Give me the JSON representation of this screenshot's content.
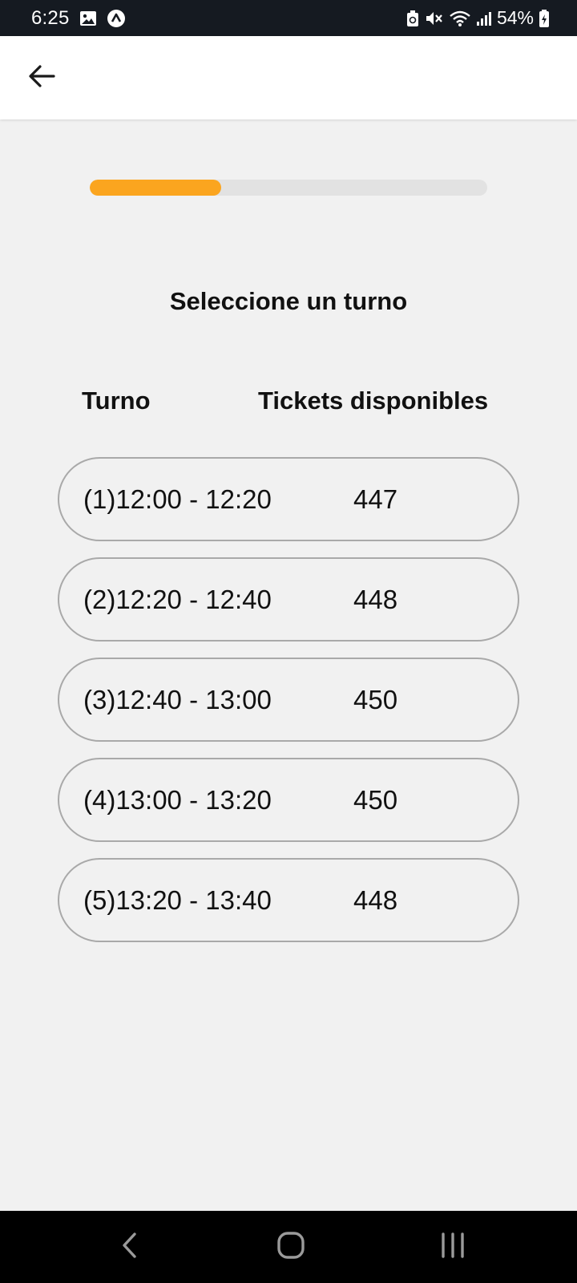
{
  "status_bar": {
    "time": "6:25",
    "battery": "54%",
    "icons": [
      "image-icon",
      "app-notification-icon",
      "recycle-icon",
      "mute-icon",
      "wifi-icon",
      "signal-icon",
      "battery-icon"
    ]
  },
  "app_bar": {
    "back_icon": "arrow-left-icon"
  },
  "progress": {
    "value": 0.33,
    "fill_color": "#fba51f",
    "track_color": "#e2e2e2"
  },
  "title": "Seleccione un turno",
  "columns": {
    "turno": "Turno",
    "tickets": "Tickets disponibles"
  },
  "turns": [
    {
      "time": "(1)12:00 - 12:20",
      "tickets": "447"
    },
    {
      "time": "(2)12:20 - 12:40",
      "tickets": "448"
    },
    {
      "time": "(3)12:40 - 13:00",
      "tickets": "450"
    },
    {
      "time": "(4)13:00 - 13:20",
      "tickets": "450"
    },
    {
      "time": "(5)13:20 - 13:40",
      "tickets": "448"
    }
  ],
  "nav_bar": {
    "icons": [
      "nav-back-icon",
      "nav-home-icon",
      "nav-recents-icon"
    ]
  }
}
